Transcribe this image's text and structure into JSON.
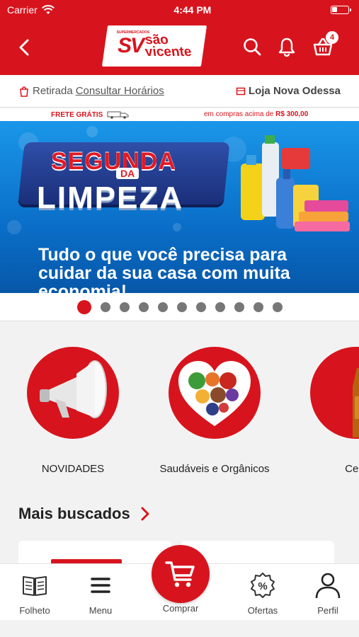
{
  "status_bar": {
    "carrier": "Carrier",
    "time": "4:44 PM",
    "battery_level": 0.35
  },
  "header": {
    "logo": {
      "mark": "SV",
      "name_line1": "são",
      "name_line2": "vicente",
      "tagline": "SUPERMERCADOS"
    },
    "cart_count": "4",
    "icons": {
      "back": "chevron-left-icon",
      "search": "search-icon",
      "notifications": "bell-icon",
      "cart": "basket-icon"
    }
  },
  "pickup": {
    "mode_label": "Retirada",
    "hours_link": "Consultar Horários",
    "store_name": "Loja Nova Odessa"
  },
  "frete": {
    "left": "FRETE GRÁTIS",
    "right_prefix": "em compras acima de",
    "right_amount": "R$ 300,00"
  },
  "banner": {
    "title_top": "SEGUNDA",
    "title_mid": "DA",
    "title_bottom": "LIMPEZA",
    "subtitle": "Tudo o que você precisa para cuidar da sua casa com muita economia!",
    "slide_count": 11,
    "active_slide": 0
  },
  "categories": [
    {
      "label": "NOVIDADES",
      "icon": "megaphone-icon"
    },
    {
      "label": "Saudáveis e Orgânicos",
      "icon": "heart-food-icon"
    },
    {
      "label": "Cerv",
      "icon": "beer-bottle-icon"
    }
  ],
  "mais_buscados": {
    "title": "Mais buscados"
  },
  "bottom_nav": {
    "items": [
      {
        "label": "Folheto",
        "icon": "book-icon"
      },
      {
        "label": "Menu",
        "icon": "hamburger-icon"
      },
      {
        "label": "Comprar",
        "icon": "cart-icon"
      },
      {
        "label": "Ofertas",
        "icon": "percent-badge-icon"
      },
      {
        "label": "Perfil",
        "icon": "user-icon"
      }
    ]
  },
  "colors": {
    "brand_red": "#d7141d",
    "banner_blue": "#0a6fc9"
  }
}
